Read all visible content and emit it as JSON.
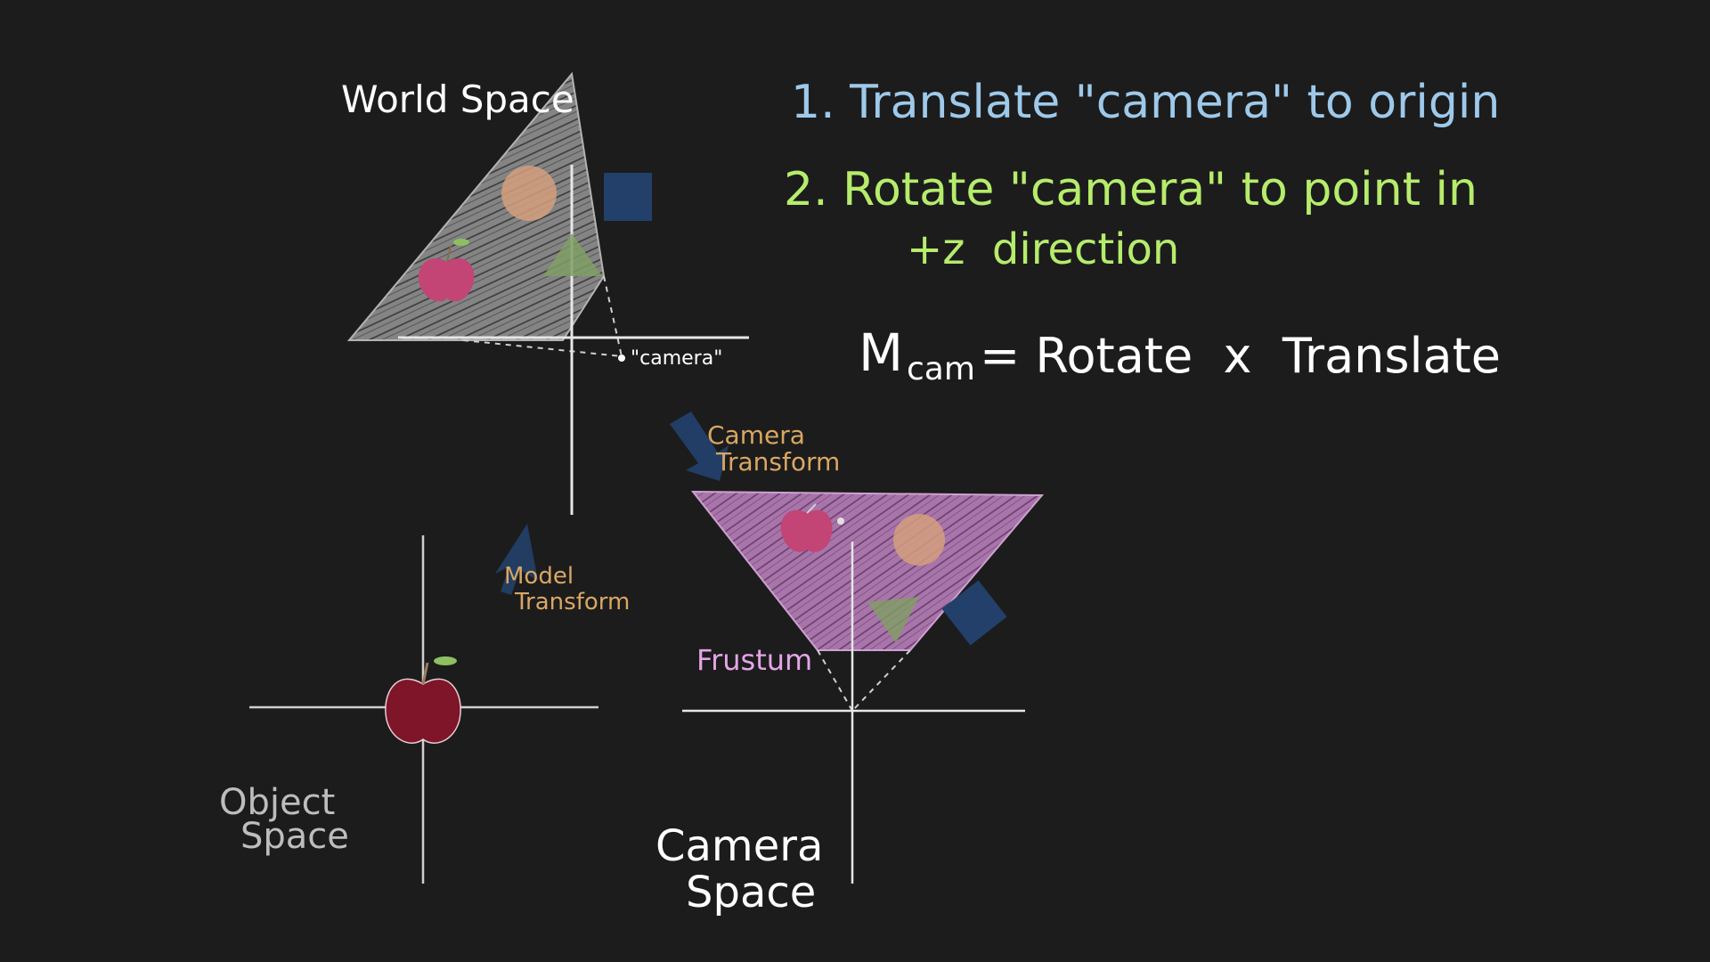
{
  "world": {
    "title": "World Space",
    "camera_label": "\"camera\""
  },
  "object": {
    "title_line1": "Object",
    "title_line2": "Space"
  },
  "camera_space": {
    "title_line1": "Camera",
    "title_line2": "Space",
    "frustum_label": "Frustum"
  },
  "transforms": {
    "model_line1": "Model",
    "model_line2": "Transform",
    "camera_line1": "Camera",
    "camera_line2": "Transform"
  },
  "steps": {
    "step1": "1. Translate \"camera\" to origin",
    "step2_line1": "2. Rotate \"camera\" to point in",
    "step2_line2": "+z  direction"
  },
  "equation": {
    "lhs": "M",
    "subscript": "cam",
    "rhs": "= Rotate  x  Translate"
  },
  "colors": {
    "background": "#1c1c1c",
    "axes": "#e6e6e6",
    "world_triangle": "#8a8a8a",
    "frustum": "#b07ab2",
    "step1": "#9ec9ea",
    "step2": "#b6ec6c",
    "transform_label": "#d9a764",
    "frustum_label": "#e3a6e6",
    "orange_circle": "#d49f7e",
    "navy_square": "#23406a",
    "green_triangle": "#7f9f64",
    "apple_pink": "#c24576",
    "apple_red": "#7e1528"
  }
}
